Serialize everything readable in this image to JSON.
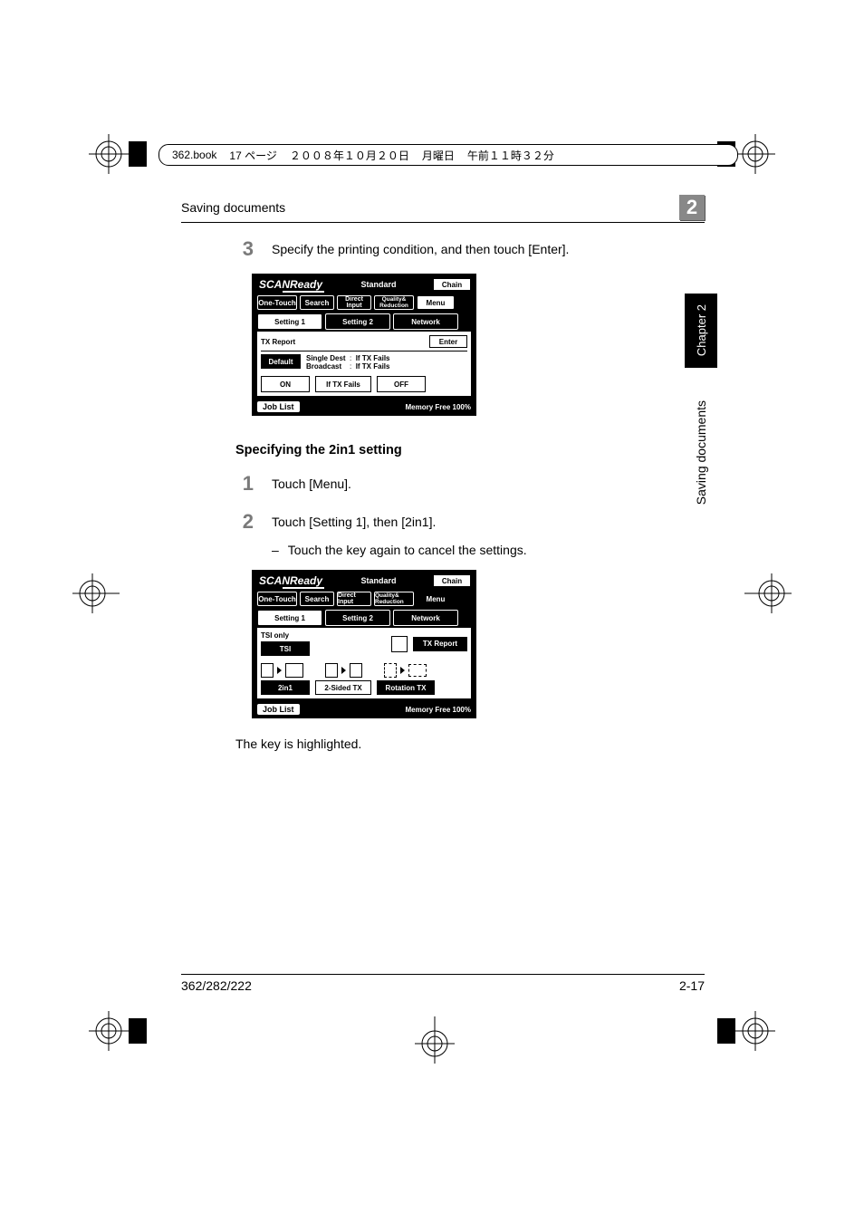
{
  "print_header": {
    "file": "362.book",
    "page_word": "17 ページ",
    "date": "２００８年１０月２０日",
    "weekday": "月曜日",
    "time": "午前１１時３２分"
  },
  "running_head": {
    "title": "Saving documents",
    "marker": "2"
  },
  "side_tab": "Chapter 2",
  "side_label": "Saving documents",
  "step3": {
    "num": "3",
    "text": "Specify the printing condition, and then touch [Enter]."
  },
  "panel1": {
    "scan": "SCANReady",
    "standard": "Standard",
    "chain": "Chain",
    "one_touch": "One-Touch",
    "search": "Search",
    "direct": "Direct Input",
    "quality": "Quality& Reduction",
    "menu": "Menu",
    "setting1": "Setting 1",
    "setting2": "Setting 2",
    "network": "Network",
    "tx_report": "TX Report",
    "enter": "Enter",
    "default": "Default",
    "single_dest": "Single Dest",
    "broadcast": "Broadcast",
    "iftx1": "If TX Fails",
    "iftx2": "If TX Fails",
    "on": "ON",
    "if_tx_fails": "If TX Fails",
    "off": "OFF",
    "job_list": "Job List",
    "memory": "Memory Free",
    "percent": "100%"
  },
  "section_title": "Specifying the 2in1 setting",
  "step1": {
    "num": "1",
    "text": "Touch [Menu]."
  },
  "step2": {
    "num": "2",
    "text": "Touch [Setting 1], then [2in1].",
    "sub_dash": "–",
    "sub": "Touch the key again to cancel the settings."
  },
  "panel2": {
    "scan": "SCANReady",
    "standard": "Standard",
    "chain": "Chain",
    "one_touch": "One-Touch",
    "search": "Search",
    "direct": "Direct Input",
    "quality": "Quality& Reduction",
    "menu": "Menu",
    "setting1": "Setting 1",
    "setting2": "Setting 2",
    "network": "Network",
    "tsi_only": "TSI only",
    "tsi": "TSI",
    "tx_report": "TX Report",
    "two_in_one": "2in1",
    "two_sided": "2-Sided TX",
    "rotation": "Rotation TX",
    "job_list": "Job List",
    "memory": "Memory Free",
    "percent": "100%"
  },
  "note": "The key is highlighted.",
  "footer": {
    "model": "362/282/222",
    "page": "2-17"
  }
}
